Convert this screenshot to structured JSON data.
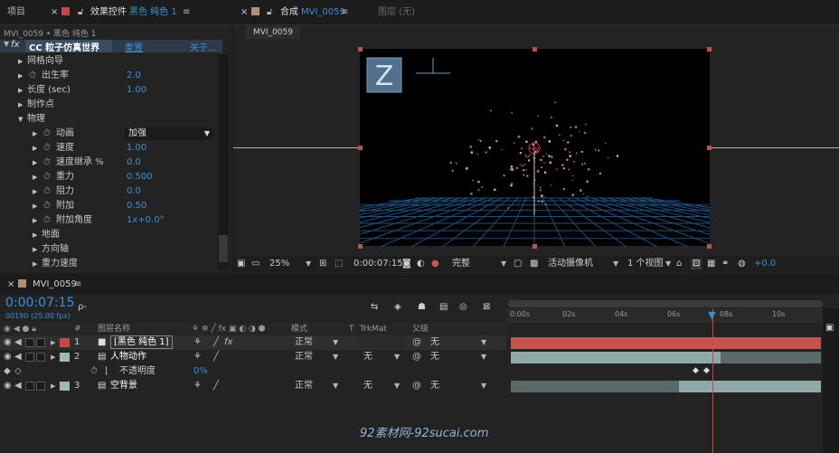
{
  "left": {
    "tab1": "项目",
    "tab2_label": "效果控件",
    "tab2_layer": "黑色 纯色 1",
    "breadcrumb": "MVI_0059 • 黑色 纯色 1",
    "effect_name": "CC 粒子仿真世界",
    "reset": "重置",
    "about": "关于...",
    "rows": [
      {
        "label": "网格向导",
        "value": "",
        "indent": 0,
        "stopwatch": false
      },
      {
        "label": "出生率",
        "value": "2.0",
        "indent": 0,
        "stopwatch": true
      },
      {
        "label": "长度 (sec)",
        "value": "1.00",
        "indent": 0,
        "stopwatch": false
      },
      {
        "label": "制作点",
        "value": "",
        "indent": 0,
        "stopwatch": false
      },
      {
        "label": "物理",
        "value": "",
        "indent": 0,
        "stopwatch": false,
        "open": true
      },
      {
        "label": "动画",
        "value": "",
        "indent": 1,
        "stopwatch": true,
        "dropdown": "加强"
      },
      {
        "label": "速度",
        "value": "1.00",
        "indent": 1,
        "stopwatch": true
      },
      {
        "label": "速度继承 %",
        "value": "0.0",
        "indent": 1,
        "stopwatch": true
      },
      {
        "label": "重力",
        "value": "0.500",
        "indent": 1,
        "stopwatch": true
      },
      {
        "label": "阻力",
        "value": "0.0",
        "indent": 1,
        "stopwatch": true
      },
      {
        "label": "附加",
        "value": "0.50",
        "indent": 1,
        "stopwatch": true
      },
      {
        "label": "附加角度",
        "value": "1x+0.0°",
        "indent": 1,
        "stopwatch": true
      },
      {
        "label": "地面",
        "value": "",
        "indent": 1,
        "stopwatch": false
      },
      {
        "label": "方向轴",
        "value": "",
        "indent": 1,
        "stopwatch": false
      },
      {
        "label": "重力速度",
        "value": "",
        "indent": 1,
        "stopwatch": false
      }
    ]
  },
  "comp": {
    "tab_label": "合成",
    "comp_name": "MVI_0059",
    "layer_tab": "图层 (无)",
    "subtab": "MVI_0059",
    "zoom": "25%",
    "timecode": "0:00:07:15",
    "quality": "完整",
    "camera": "活动摄像机",
    "views": "1 个视图",
    "exposure": "+0.0"
  },
  "timeline": {
    "tab": "MVI_0059",
    "timecode": "0:00:07:15",
    "fps": "00190 (25.00 fps)",
    "search_placeholder": "ρ-",
    "headers": {
      "num": "#",
      "name": "图层名称",
      "mode": "模式",
      "t": "T",
      "trkmat": "TrkMat",
      "parent": "父级"
    },
    "ticks": [
      "0:00s",
      "02s",
      "04s",
      "06s",
      "08s",
      "10s"
    ],
    "layers": [
      {
        "num": "1",
        "name": "[黑色 纯色 1]",
        "mode": "正常",
        "trkmat": "",
        "parent": "无",
        "color": "#c44a4a",
        "selected": true
      },
      {
        "num": "2",
        "name": "人物动作",
        "mode": "正常",
        "trkmat": "无",
        "parent": "无",
        "color": "#9fb7b7"
      },
      {
        "num": "3",
        "name": "空背景",
        "mode": "正常",
        "trkmat": "无",
        "parent": "无",
        "color": "#9fb7b7"
      }
    ],
    "sub_property": {
      "name": "不透明度",
      "value": "0%"
    },
    "playhead_fraction": 0.65
  },
  "watermark": "92素材网-92sucai.com"
}
